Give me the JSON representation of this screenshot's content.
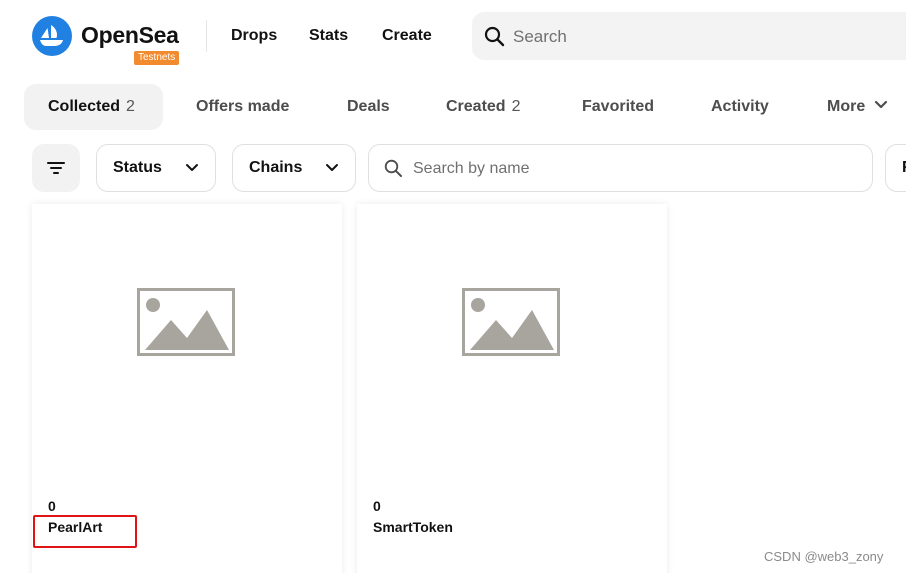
{
  "header": {
    "brand": "OpenSea",
    "badge": "Testnets",
    "nav": [
      "Drops",
      "Stats",
      "Create"
    ],
    "search_placeholder": "Search"
  },
  "tabs": [
    {
      "label": "Collected",
      "count": "2",
      "active": true
    },
    {
      "label": "Offers made"
    },
    {
      "label": "Deals"
    },
    {
      "label": "Created",
      "count": "2"
    },
    {
      "label": "Favorited"
    },
    {
      "label": "Activity"
    },
    {
      "label": "More",
      "has_chevron": true
    }
  ],
  "filters": {
    "status_label": "Status",
    "chains_label": "Chains",
    "name_search_placeholder": "Search by name",
    "extra_label": "F"
  },
  "cards": [
    {
      "price": "0",
      "name": "PearlArt"
    },
    {
      "price": "0",
      "name": "SmartToken"
    }
  ],
  "colors": {
    "brand_blue": "#2081e2",
    "badge_orange": "#f28a2e",
    "highlight_red": "#e01414",
    "placeholder_gray": "#a8a49e"
  },
  "watermark": "CSDN @web3_zony"
}
